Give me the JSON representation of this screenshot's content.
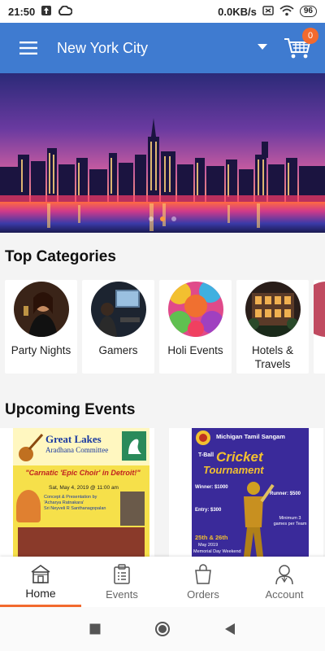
{
  "status_bar": {
    "time": "21:50",
    "network_speed": "0.0KB/s",
    "battery": "96"
  },
  "app_bar": {
    "city": "New York City",
    "cart_count": "0",
    "accent_color": "#3f7bd0",
    "badge_color": "#f26a2e"
  },
  "sections": {
    "top_categories": "Top Categories",
    "upcoming_events": "Upcoming Events"
  },
  "categories": [
    {
      "label": "Party Nights",
      "icon": "party-photo"
    },
    {
      "label": "Gamers",
      "icon": "gamers-photo"
    },
    {
      "label": "Holi Events",
      "icon": "holi-photo"
    },
    {
      "label": "Hotels & Travels",
      "icon": "hotel-photo"
    }
  ],
  "events": [
    {
      "org_title": "Great Lakes",
      "org_subtitle": "Aradhana Committee",
      "headline": "\"Carnatic 'Epic Choir' in Detroit!\"",
      "date_line": "Sat, May 4, 2019 @ 11:00 am",
      "credit_lines": [
        "Concept & Presentation by",
        "'Acharya Ratnakara'",
        "Sri Neyveli R Santhanagopalan"
      ]
    },
    {
      "org_title": "Michigan Tamil Sangam",
      "headline_top": "T-Ball",
      "headline_main": "Cricket",
      "headline_sub": "Tournament",
      "winner": "Winner: $1000",
      "runner": "Runner: $500",
      "entry": "Entry: $300",
      "minimum": "Minimum 3 games per Team",
      "dates": "25th & 26th",
      "month": "May 2019",
      "weekend": "Memorial Day Weekend"
    }
  ],
  "bottom_nav": [
    {
      "label": "Home",
      "icon": "home-icon",
      "active": true
    },
    {
      "label": "Events",
      "icon": "events-icon",
      "active": false
    },
    {
      "label": "Orders",
      "icon": "orders-icon",
      "active": false
    },
    {
      "label": "Account",
      "icon": "account-icon",
      "active": false
    }
  ]
}
